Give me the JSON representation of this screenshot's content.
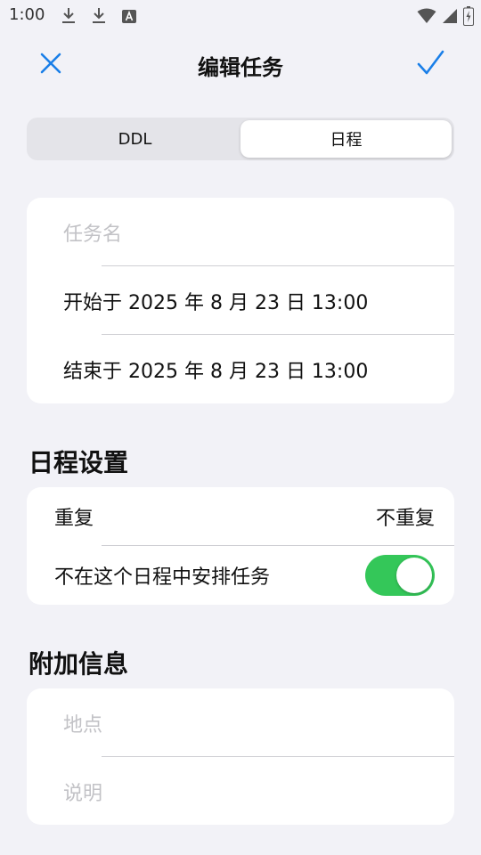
{
  "status_bar": {
    "time": "1:00"
  },
  "header": {
    "title": "编辑任务"
  },
  "segments": [
    {
      "label": "DDL",
      "selected": false
    },
    {
      "label": "日程",
      "selected": true
    }
  ],
  "task": {
    "name_placeholder": "任务名",
    "start": "开始于 2025 年 8 月 23 日 13:00",
    "end": "结束于 2025 年 8 月 23 日 13:00"
  },
  "schedule": {
    "section_title": "日程设置",
    "repeat_label": "重复",
    "repeat_value": "不重复",
    "no_arrange_label": "不在这个日程中安排任务",
    "no_arrange_on": true
  },
  "extra": {
    "section_title": "附加信息",
    "location_placeholder": "地点",
    "description_placeholder": "说明"
  },
  "colors": {
    "accent": "#1a7fe8",
    "toggle_on": "#34c759",
    "background": "#f2f2f7"
  }
}
